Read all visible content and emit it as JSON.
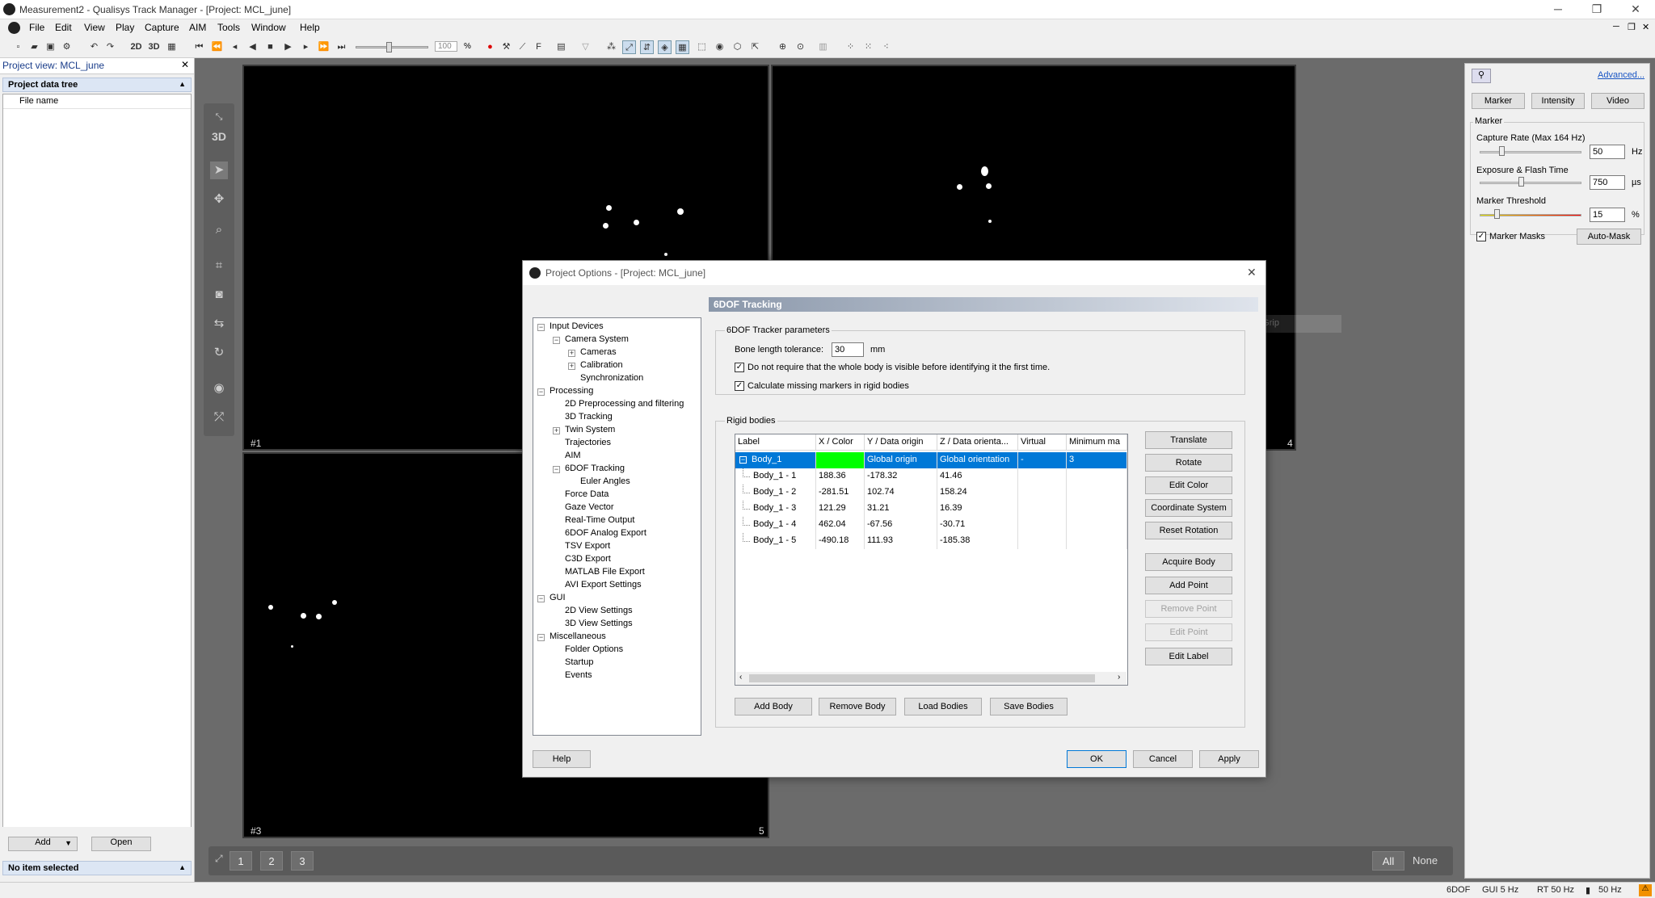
{
  "window": {
    "title": "Measurement2 - Qualisys Track Manager - [Project: MCL_june]"
  },
  "menu": [
    "File",
    "Edit",
    "View",
    "Play",
    "Capture",
    "AIM",
    "Tools",
    "Window",
    "Help"
  ],
  "toolbar": {
    "twoD": "2D",
    "threeD": "3D",
    "zoom": "100",
    "zoom_unit": "%"
  },
  "left_panel": {
    "title": "Project view: MCL_june",
    "section": "Project data tree",
    "column": "File name",
    "add_label": "Add",
    "open_label": "Open",
    "status": "No item selected"
  },
  "views": {
    "labels": [
      "#1",
      "4",
      "#3",
      "5"
    ],
    "tools_3d": "3D",
    "view_buttons": [
      "1",
      "2",
      "3"
    ],
    "all": "All",
    "none": "None",
    "ghost_tab": "Window Grip"
  },
  "right_panel": {
    "advanced": "Advanced...",
    "tabs": [
      "Marker",
      "Intensity",
      "Video"
    ],
    "group": "Marker",
    "capture_rate_label": "Capture Rate (Max 164 Hz)",
    "capture_rate": "50",
    "capture_unit": "Hz",
    "capture_level": 0.2,
    "exposure_label": "Exposure & Flash Time",
    "exposure": "750",
    "exposure_unit": "µs",
    "exposure_level": 0.4,
    "threshold_label": "Marker Threshold",
    "threshold": "15",
    "threshold_unit": "%",
    "threshold_level": 0.15,
    "masks_label": "Marker Masks",
    "automask_label": "Auto-Mask"
  },
  "status_bar": [
    "6DOF",
    "GUI 5 Hz",
    "RT 50 Hz",
    "50 Hz"
  ],
  "dialog": {
    "title": "Project Options - [Project: MCL_june]",
    "tree": [
      {
        "label": "Input Devices",
        "level": 0,
        "expander": "-"
      },
      {
        "label": "Camera System",
        "level": 1,
        "expander": "-"
      },
      {
        "label": "Cameras",
        "level": 2,
        "expander": "+"
      },
      {
        "label": "Calibration",
        "level": 2,
        "expander": "+"
      },
      {
        "label": "Synchronization",
        "level": 2,
        "expander": ""
      },
      {
        "label": "Processing",
        "level": 0,
        "expander": "-"
      },
      {
        "label": "2D Preprocessing and filtering",
        "level": 1,
        "expander": ""
      },
      {
        "label": "3D Tracking",
        "level": 1,
        "expander": ""
      },
      {
        "label": "Twin System",
        "level": 1,
        "expander": "+"
      },
      {
        "label": "Trajectories",
        "level": 1,
        "expander": ""
      },
      {
        "label": "AIM",
        "level": 1,
        "expander": ""
      },
      {
        "label": "6DOF Tracking",
        "level": 1,
        "expander": "-"
      },
      {
        "label": "Euler Angles",
        "level": 2,
        "expander": ""
      },
      {
        "label": "Force Data",
        "level": 1,
        "expander": ""
      },
      {
        "label": "Gaze Vector",
        "level": 1,
        "expander": ""
      },
      {
        "label": "Real-Time Output",
        "level": 1,
        "expander": ""
      },
      {
        "label": "6DOF Analog Export",
        "level": 1,
        "expander": ""
      },
      {
        "label": "TSV Export",
        "level": 1,
        "expander": ""
      },
      {
        "label": "C3D Export",
        "level": 1,
        "expander": ""
      },
      {
        "label": "MATLAB File Export",
        "level": 1,
        "expander": ""
      },
      {
        "label": "AVI Export Settings",
        "level": 1,
        "expander": ""
      },
      {
        "label": "GUI",
        "level": 0,
        "expander": "-"
      },
      {
        "label": "2D View Settings",
        "level": 1,
        "expander": ""
      },
      {
        "label": "3D View Settings",
        "level": 1,
        "expander": ""
      },
      {
        "label": "Miscellaneous",
        "level": 0,
        "expander": "-"
      },
      {
        "label": "Folder Options",
        "level": 1,
        "expander": ""
      },
      {
        "label": "Startup",
        "level": 1,
        "expander": ""
      },
      {
        "label": "Events",
        "level": 1,
        "expander": ""
      }
    ],
    "page_title": "6DOF Tracking",
    "tracker_group": "6DOF Tracker parameters",
    "bone_label": "Bone length tolerance:",
    "bone_value": "30",
    "bone_unit": "mm",
    "check1": "Do not require that the whole body is visible before identifying it the first time.",
    "check2": "Calculate missing markers in rigid bodies",
    "rigid_group": "Rigid bodies",
    "columns": [
      "Label",
      "X / Color",
      "Y / Data origin",
      "Z / Data orienta...",
      "Virtual",
      "Minimum ma"
    ],
    "body": {
      "label": "Body_1",
      "color": "#00ff00",
      "y": "Global origin",
      "z": "Global orientation",
      "virtual": "-",
      "min": "3"
    },
    "points": [
      {
        "label": "Body_1 - 1",
        "x": "188.36",
        "y": "-178.32",
        "z": "41.46"
      },
      {
        "label": "Body_1 - 2",
        "x": "-281.51",
        "y": "102.74",
        "z": "158.24"
      },
      {
        "label": "Body_1 - 3",
        "x": "121.29",
        "y": "31.21",
        "z": "16.39"
      },
      {
        "label": "Body_1 - 4",
        "x": "462.04",
        "y": "-67.56",
        "z": "-30.71"
      },
      {
        "label": "Body_1 - 5",
        "x": "-490.18",
        "y": "111.93",
        "z": "-185.38"
      }
    ],
    "side_buttons": [
      "Translate",
      "Rotate",
      "Edit Color",
      "Coordinate System",
      "Reset Rotation"
    ],
    "side_buttons2": [
      "Acquire Body",
      "Add Point",
      "Remove Point",
      "Edit Point",
      "Edit Label"
    ],
    "bottom_buttons": [
      "Add Body",
      "Remove Body",
      "Load Bodies",
      "Save Bodies"
    ],
    "help": "Help",
    "ok": "OK",
    "cancel": "Cancel",
    "apply": "Apply"
  }
}
